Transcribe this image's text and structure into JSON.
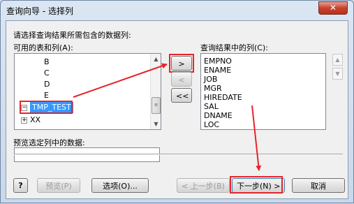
{
  "window": {
    "title": "查询向导 - 选择列",
    "close_glyph": "✕"
  },
  "prompt": "请选择查询结果所需包含的数据列:",
  "available": {
    "label": "可用的表和列(A):",
    "items": [
      "B",
      "C",
      "D",
      "E"
    ],
    "table_selected": "TMP_TEST",
    "table_next": "XX",
    "collapse_glyph": "−",
    "expand_glyph": "+"
  },
  "result": {
    "label": "查询结果中的列(C):",
    "columns": [
      "EMPNO",
      "ENAME",
      "JOB",
      "MGR",
      "HIREDATE",
      "SAL",
      "DNAME",
      "LOC"
    ]
  },
  "move_buttons": {
    "add": ">",
    "remove": "<",
    "remove_all": "<<"
  },
  "preview": {
    "label": "预览选定列中的数据:",
    "value": ""
  },
  "footer": {
    "help_glyph": "?",
    "preview_label": "预览(P)",
    "options_label": "选项(O)...",
    "back_label": "< 上一步(B)",
    "next_label": "下一步(N) >",
    "cancel_label": "取消"
  },
  "icons": {
    "up": "▲",
    "down": "▼",
    "thumb_grip": "≡"
  },
  "colors": {
    "highlight": "#e8242b",
    "selection": "#3399ff"
  }
}
